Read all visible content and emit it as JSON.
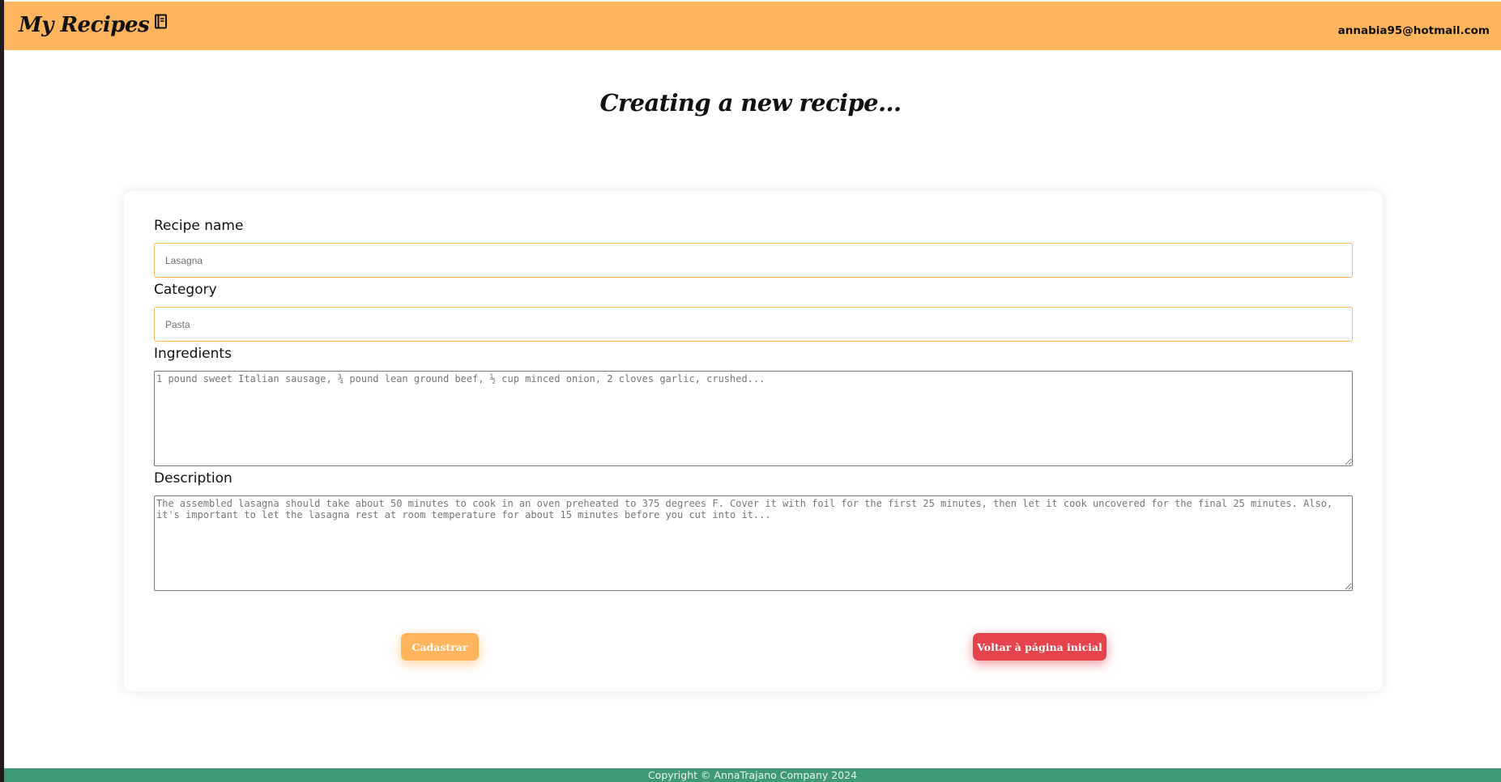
{
  "navbar": {
    "brand": "My Recipes",
    "brand_icon": "recipe-book-icon",
    "user_email": "annabia95@hotmail.com"
  },
  "page": {
    "title": "Creating a new recipe..."
  },
  "form": {
    "recipe_name": {
      "label": "Recipe name",
      "value": "",
      "placeholder": "Lasagna"
    },
    "category": {
      "label": "Category",
      "value": "",
      "placeholder": "Pasta"
    },
    "ingredients": {
      "label": "Ingredients",
      "value": "",
      "placeholder": "1 pound sweet Italian sausage, ¾ pound lean ground beef, ½ cup minced onion, 2 cloves garlic, crushed..."
    },
    "description": {
      "label": "Description",
      "value": "",
      "placeholder": "The assembled lasagna should take about 50 minutes to cook in an oven preheated to 375 degrees F. Cover it with foil for the first 25 minutes, then let it cook uncovered for the final 25 minutes. Also, it's important to let the lasagna rest at room temperature for about 15 minutes before you cut into it..."
    },
    "submit_label": "Cadastrar",
    "back_label": "Voltar à página inicial"
  },
  "footer": {
    "text": "Copyright © AnnaTrajano Company 2024"
  },
  "colors": {
    "navbar": "#ffb55e",
    "submit": "#ffb55e",
    "back": "#e5434c",
    "footer": "#3e9a76"
  }
}
